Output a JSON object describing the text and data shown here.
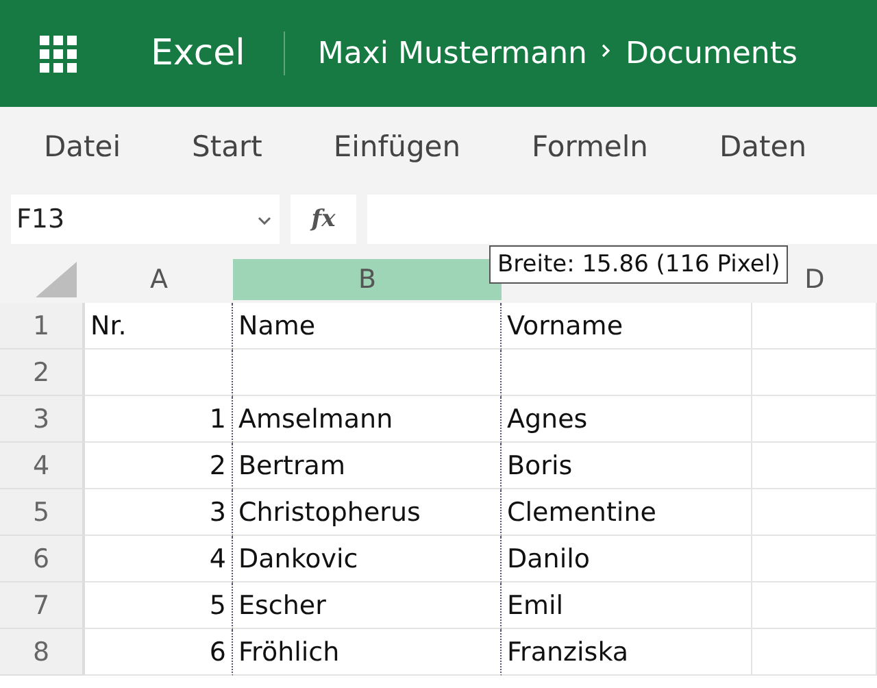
{
  "header": {
    "app": "Excel",
    "breadcrumb": [
      "Maxi Mustermann",
      "Documents"
    ]
  },
  "ribbon_tabs": [
    {
      "label": "Datei",
      "selected": false
    },
    {
      "label": "Start",
      "selected": false
    },
    {
      "label": "Einfügen",
      "selected": false
    },
    {
      "label": "Formeln",
      "selected": false
    },
    {
      "label": "Daten",
      "selected": false
    }
  ],
  "formula_bar": {
    "name_box": "F13",
    "function_button": "fx"
  },
  "columns": [
    {
      "label": "A",
      "selected": false
    },
    {
      "label": "B",
      "selected": true
    },
    {
      "selected": false
    },
    {
      "label": "D",
      "selected": false
    }
  ],
  "tooltip": "Breite: 15.86 (116 Pixel)",
  "rows": [
    {
      "number": "1",
      "kind": "label",
      "cells": [
        "Nr.",
        "Name",
        "Vorname"
      ]
    },
    {
      "number": "2",
      "kind": "empty"
    },
    {
      "number": "3",
      "kind": "entry",
      "cells": [
        "1",
        "Amselmann",
        "Agnes"
      ]
    },
    {
      "number": "4",
      "kind": "entry",
      "cells": [
        "2",
        "Bertram",
        "Boris"
      ]
    },
    {
      "number": "5",
      "kind": "entry",
      "cells": [
        "3",
        "Christopherus",
        "Clementine"
      ]
    },
    {
      "number": "6",
      "kind": "entry",
      "cells": [
        "4",
        "Dankovic",
        "Danilo"
      ]
    },
    {
      "number": "7",
      "kind": "entry",
      "cells": [
        "5",
        "Escher",
        "Emil"
      ]
    },
    {
      "number": "8",
      "kind": "entry",
      "cells": [
        "6",
        "Fröhlich",
        "Franziska"
      ]
    }
  ]
}
